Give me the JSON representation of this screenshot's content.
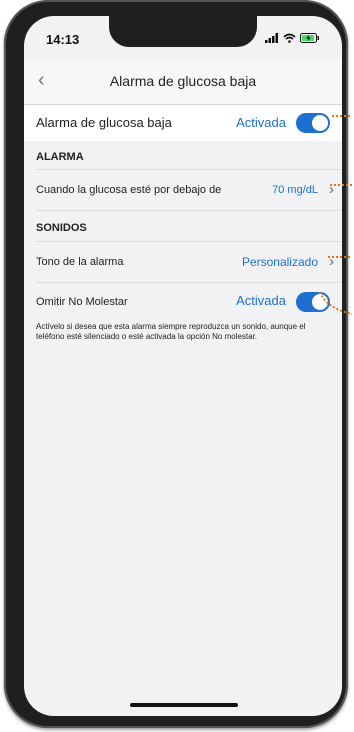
{
  "status_bar": {
    "time": "14:13"
  },
  "nav": {
    "title": "Alarma de glucosa baja",
    "back_icon": "chevron-left-icon"
  },
  "main_toggle": {
    "label": "Alarma de glucosa baja",
    "state_text": "Activada",
    "on": true
  },
  "sections": {
    "alarm_header": "ALARMA",
    "sounds_header": "SONIDOS"
  },
  "threshold_row": {
    "label": "Cuando la glucosa esté por debajo de",
    "value": "70 mg/dL"
  },
  "tone_row": {
    "label": "Tono de la alarma",
    "value": "Personalizado"
  },
  "dnd_row": {
    "label": "Omitir No Molestar",
    "state_text": "Activada",
    "on": true
  },
  "dnd_note": "Actívelo si desea que esta alarma siempre reproduzca un sonido, aunque el teléfono esté silenciado o esté activada la opción No molestar.",
  "colors": {
    "accent": "#1d6fd1",
    "callout": "#e0741a"
  }
}
